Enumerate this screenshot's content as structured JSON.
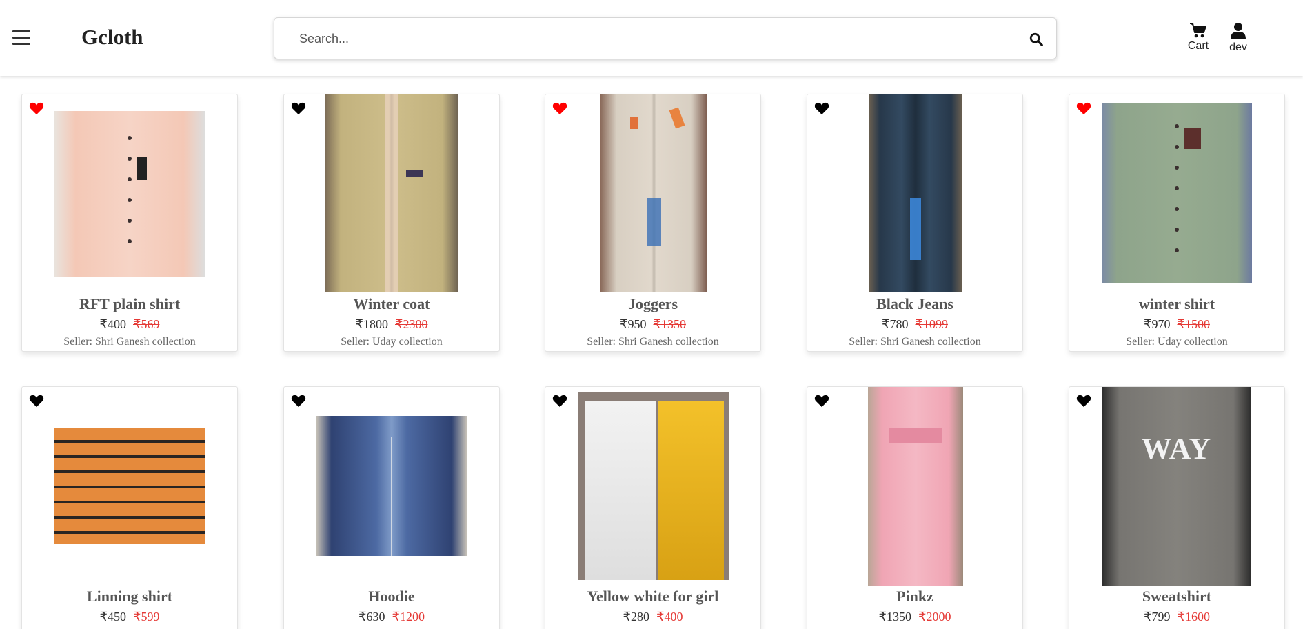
{
  "header": {
    "logo": "Gcloth",
    "search_placeholder": "Search...",
    "cart_label": "Cart",
    "user_label": "dev"
  },
  "products": [
    {
      "name": "RFT plain shirt",
      "price": "₹400",
      "mrp": "₹569",
      "seller": "Seller: Shri Ganesh collection",
      "favorite": true
    },
    {
      "name": "Winter coat",
      "price": "₹1800",
      "mrp": "₹2300",
      "seller": "Seller: Uday collection",
      "favorite": false
    },
    {
      "name": "Joggers",
      "price": "₹950",
      "mrp": "₹1350",
      "seller": "Seller: Shri Ganesh collection",
      "favorite": true
    },
    {
      "name": "Black Jeans",
      "price": "₹780",
      "mrp": "₹1099",
      "seller": "Seller: Shri Ganesh collection",
      "favorite": false
    },
    {
      "name": "winter shirt",
      "price": "₹970",
      "mrp": "₹1500",
      "seller": "Seller: Uday collection",
      "favorite": true
    },
    {
      "name": "Linning shirt",
      "price": "₹450",
      "mrp": "₹599",
      "favorite": false
    },
    {
      "name": "Hoodie",
      "price": "₹630",
      "mrp": "₹1200",
      "favorite": false
    },
    {
      "name": "Yellow white for girl",
      "price": "₹280",
      "mrp": "₹400",
      "favorite": false
    },
    {
      "name": "Pinkz",
      "price": "₹1350",
      "mrp": "₹2000",
      "favorite": false
    },
    {
      "name": "Sweatshirt",
      "price": "₹799",
      "mrp": "₹1600",
      "favorite": false,
      "print_text": "WAY"
    }
  ],
  "colors": {
    "favorite_heart": "#ff0000",
    "heart": "#000000",
    "strike_price": "#e53935",
    "product_name": "#555555"
  }
}
